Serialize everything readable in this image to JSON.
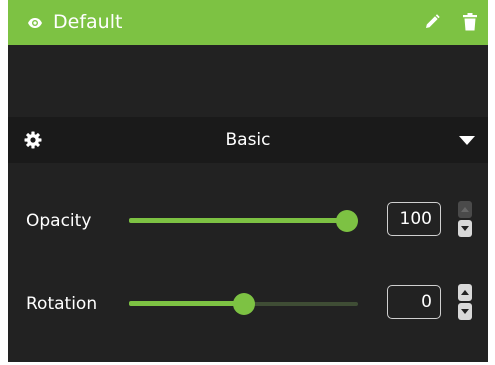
{
  "layer": {
    "name": "Default",
    "visible": true,
    "icons": [
      "eye-icon",
      "pencil-icon",
      "trash-icon"
    ]
  },
  "section": {
    "title": "Basic",
    "icons": [
      "gear-icon",
      "caret-down-icon"
    ],
    "expanded": true
  },
  "opacity": {
    "label": "Opacity",
    "value": "100",
    "slider_fraction": 1.0,
    "up_enabled": false
  },
  "rotation": {
    "label": "Rotation",
    "value": "0",
    "slider_fraction": 0.5,
    "up_enabled": true
  },
  "colors": {
    "accent": "#7dc243",
    "panel_bg": "#222222",
    "section_bg": "#1a1a1a",
    "track_empty": "#3f4d35",
    "text": "#ffffff"
  }
}
